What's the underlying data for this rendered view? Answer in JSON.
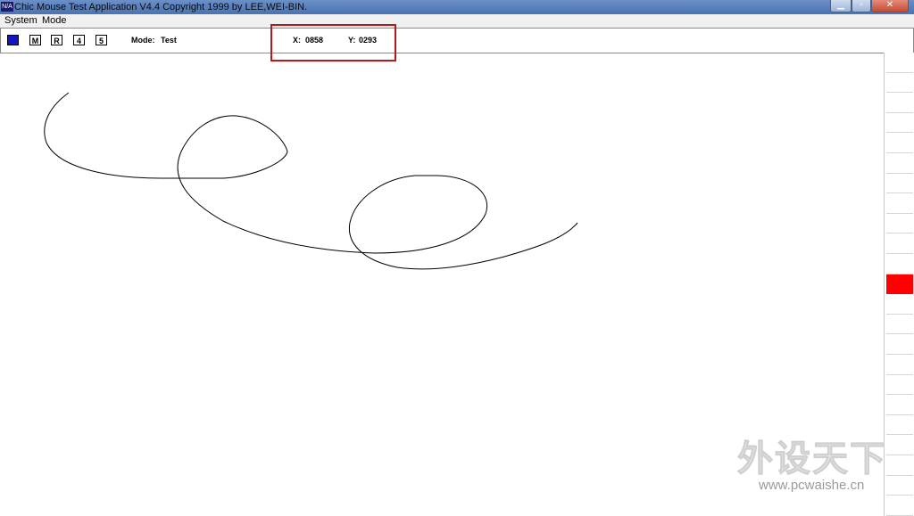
{
  "window": {
    "title": "Chic Mouse Test Application V4.4 Copyright 1999 by LEE,WEI-BIN.",
    "icon_text": "N/A"
  },
  "menu": {
    "items": [
      "System",
      "Mode"
    ]
  },
  "toolbar": {
    "buttons": [
      {
        "label": "",
        "color": "#1414c8"
      },
      {
        "label": "M"
      },
      {
        "label": "R"
      },
      {
        "label": "4"
      },
      {
        "label": "5"
      }
    ],
    "mode_label": "Mode:",
    "mode_value": "Test",
    "x_label": "X:",
    "x_value": "0858",
    "y_label": "Y:",
    "y_value": "0293"
  },
  "indicator": {
    "total_cells": 23,
    "active_cell": 11,
    "active_color": "#ff0000"
  },
  "watermark": {
    "logo": "外设天下",
    "url": "www.pcwaishe.cn"
  },
  "colors": {
    "highlight": "#b31b1b"
  }
}
